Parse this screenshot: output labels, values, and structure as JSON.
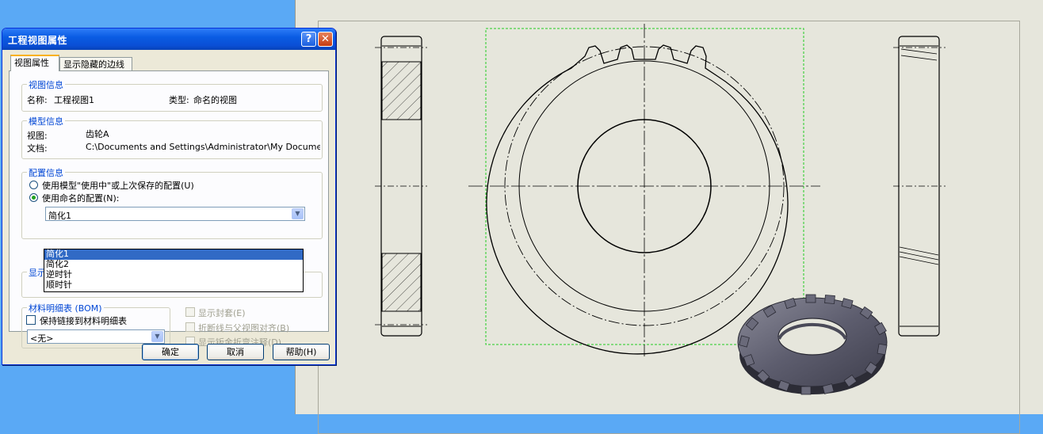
{
  "dialog": {
    "title": "工程视图属性",
    "titlebar_help": "?",
    "titlebar_close": "✕",
    "tabs": [
      {
        "label": "视图属性"
      },
      {
        "label": "显示隐藏的边线"
      }
    ],
    "view_info": {
      "title": "视图信息",
      "name_label": "名称:",
      "name_value": "工程视图1",
      "type_label": "类型:",
      "type_value": "命名的视图"
    },
    "model_info": {
      "title": "模型信息",
      "view_label": "视图:",
      "view_value": "齿轮A",
      "doc_label": "文档:",
      "doc_value": "C:\\Documents and Settings\\Administrator\\My Documents\\齿"
    },
    "config_info": {
      "title": "配置信息",
      "option_inuse": "使用模型\"使用中\"或上次保存的配置(U)",
      "option_named": "使用命名的配置(N):",
      "selected": "简化1",
      "options": [
        "简化1",
        "简化2",
        "逆时针",
        "顺时针"
      ]
    },
    "display_group_title": "显示",
    "bom": {
      "title": "材料明细表 (BOM)",
      "keep_link": "保持链接到材料明细表",
      "select_value": "<无>"
    },
    "options": {
      "show_envelopes": "显示封套(E)",
      "break_align": "折断线与父视图对齐(B)",
      "sheetmetal_notes": "显示钣金折弯注释(D)"
    },
    "buttons": {
      "ok": "确定",
      "cancel": "取消",
      "help": "帮助(H)"
    }
  },
  "icons": {
    "dropdown_arrow": "chevron-down-icon"
  },
  "colors": {
    "desktop": "#5aa9f5",
    "titlebar": "#0a5ce3",
    "dialog_bg": "#ece9d8",
    "sheet_bg": "#e6e6dc",
    "selection": "#316ac5",
    "group_title": "#0046d5",
    "view_box": "#22cc22"
  }
}
